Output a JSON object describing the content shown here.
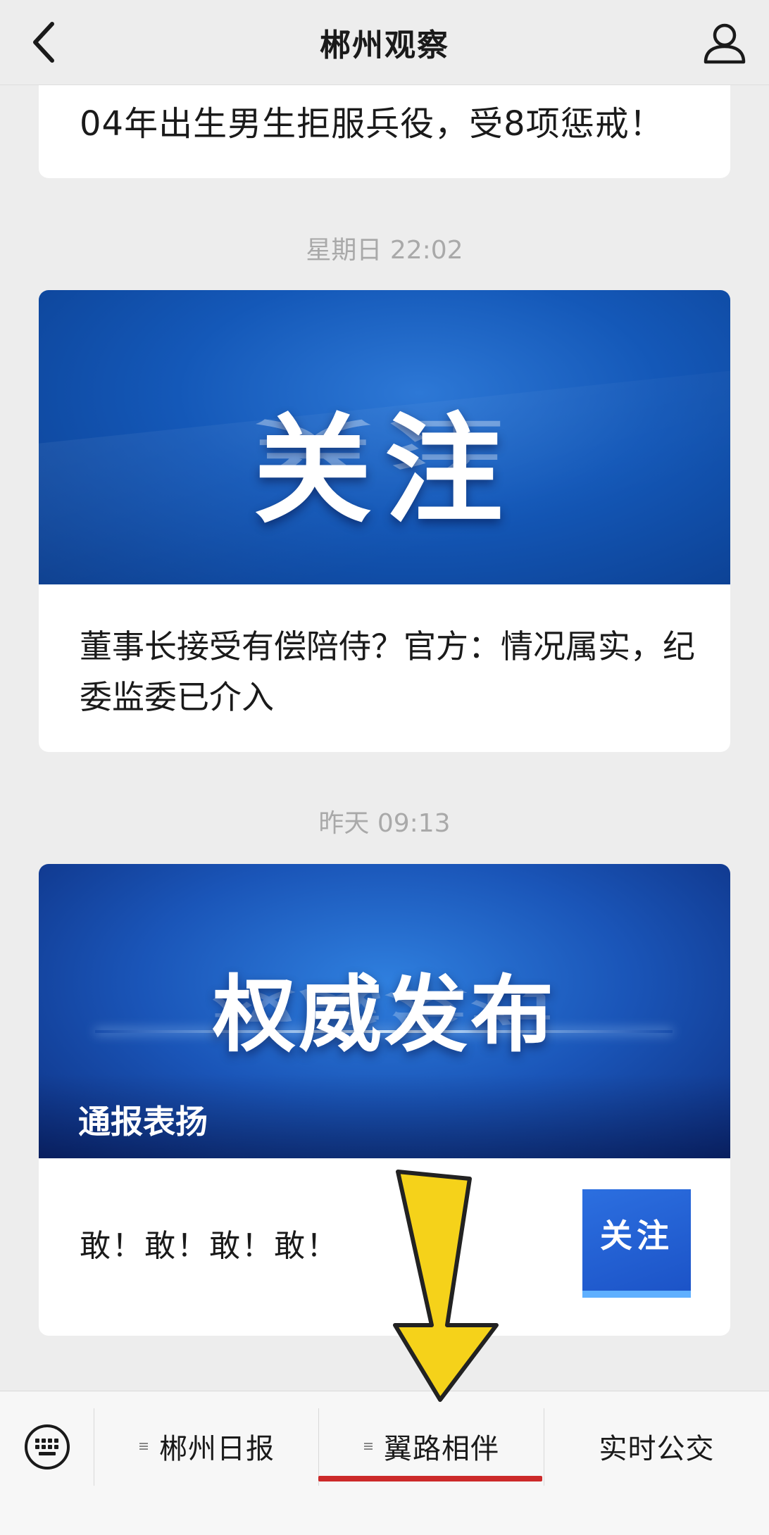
{
  "header": {
    "title": "郴州观察"
  },
  "feed": {
    "top_card": {
      "title": "04年出生男生拒服兵役，受8项惩戒！"
    },
    "timestamp_1": "星期日 22:02",
    "article_1": {
      "cover_text": "关注",
      "title": "董事长接受有偿陪侍？官方：情况属实，纪委监委已介入"
    },
    "timestamp_2": "昨天 09:13",
    "article_2": {
      "cover_text": "权威发布",
      "cover_caption": "通报表扬",
      "sub_title": "敢！敢！敢！敢！",
      "thumb_text": "关注"
    }
  },
  "bottom_menu": {
    "items": [
      {
        "label": "郴州日报"
      },
      {
        "label": "翼路相伴"
      },
      {
        "label": "实时公交"
      }
    ],
    "active_index": 1,
    "accent_color": "#cc2a2a"
  },
  "overlay": {
    "arrow_color": "#f5d21a"
  }
}
